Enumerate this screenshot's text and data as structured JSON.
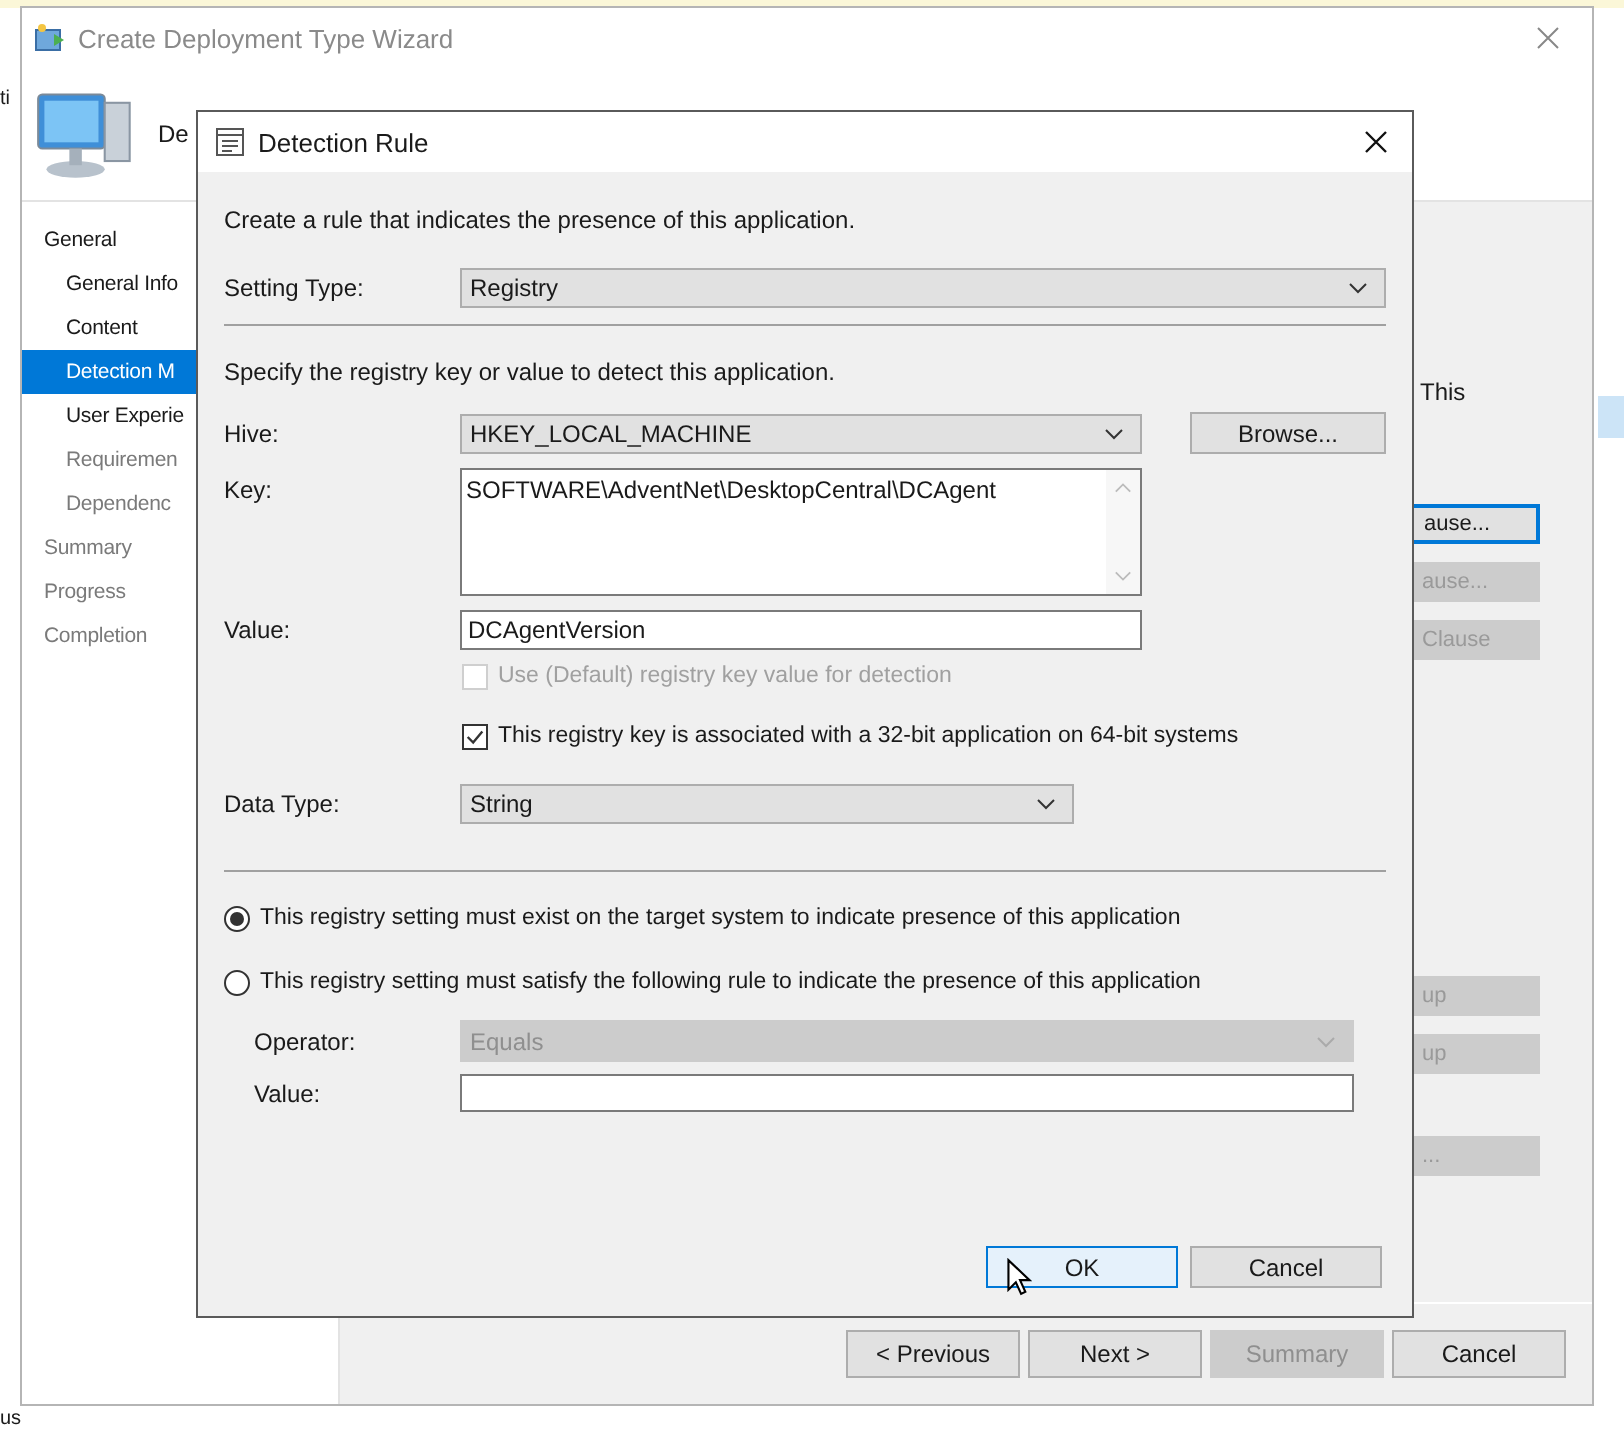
{
  "background_window": {
    "fragment_top": "ti",
    "fragment_bottom": "us"
  },
  "wizard": {
    "title": "Create Deployment Type Wizard",
    "header_title": "De",
    "nav": [
      {
        "label": "General",
        "selected": false,
        "disabled": false,
        "children": [
          {
            "label": "General Info",
            "selected": false,
            "disabled": false
          },
          {
            "label": "Content",
            "selected": false,
            "disabled": false
          },
          {
            "label": "Detection M",
            "selected": true,
            "disabled": false
          },
          {
            "label": "User Experie",
            "selected": false,
            "disabled": false
          },
          {
            "label": "Requiremen",
            "selected": false,
            "disabled": true
          },
          {
            "label": "Dependenc",
            "selected": false,
            "disabled": true
          }
        ]
      },
      {
        "label": "Summary",
        "selected": false,
        "disabled": true
      },
      {
        "label": "Progress",
        "selected": false,
        "disabled": true
      },
      {
        "label": "Completion",
        "selected": false,
        "disabled": true
      }
    ],
    "content_text": "This",
    "side_buttons": [
      {
        "label": "ause...",
        "disabled": false,
        "focused": true
      },
      {
        "label": "ause...",
        "disabled": true,
        "focused": false
      },
      {
        "label": "Clause",
        "disabled": true,
        "focused": false
      },
      {
        "label": "up",
        "disabled": true,
        "focused": false
      },
      {
        "label": "up",
        "disabled": true,
        "focused": false
      },
      {
        "label": "...",
        "disabled": true,
        "focused": false
      }
    ],
    "buttons": [
      {
        "label": "< Previous",
        "disabled": false
      },
      {
        "label": "Next >",
        "disabled": false
      },
      {
        "label": "Summary",
        "disabled": true
      },
      {
        "label": "Cancel",
        "disabled": false
      }
    ]
  },
  "dialog": {
    "title": "Detection Rule",
    "intro": "Create a rule that indicates the presence of this application.",
    "setting_type": {
      "label": "Setting Type:",
      "value": "Registry"
    },
    "instruction": "Specify the registry key or value to detect this application.",
    "hive": {
      "label": "Hive:",
      "value": "HKEY_LOCAL_MACHINE"
    },
    "browse_button": "Browse...",
    "key": {
      "label": "Key:",
      "value": "SOFTWARE\\AdventNet\\DesktopCentral\\DCAgent"
    },
    "value_field": {
      "label": "Value:",
      "value": "DCAgentVersion"
    },
    "use_default": {
      "label": "Use (Default) registry key value for detection",
      "checked": false,
      "disabled": true
    },
    "is_32bit": {
      "label": "This registry key is associated with a 32-bit application on 64-bit systems",
      "checked": true,
      "disabled": false
    },
    "data_type": {
      "label": "Data Type:",
      "value": "String"
    },
    "rules": [
      {
        "label": "This registry setting must exist on the target system to indicate presence of this application",
        "selected": true
      },
      {
        "label": "This registry setting must satisfy the following rule to indicate the presence of this application",
        "selected": false
      }
    ],
    "operator": {
      "label": "Operator:",
      "value": "Equals",
      "disabled": true
    },
    "rule_value": {
      "label": "Value:",
      "disabled": false
    },
    "buttons": [
      {
        "label": "OK",
        "default": true
      },
      {
        "label": "Cancel",
        "default": false
      }
    ]
  }
}
